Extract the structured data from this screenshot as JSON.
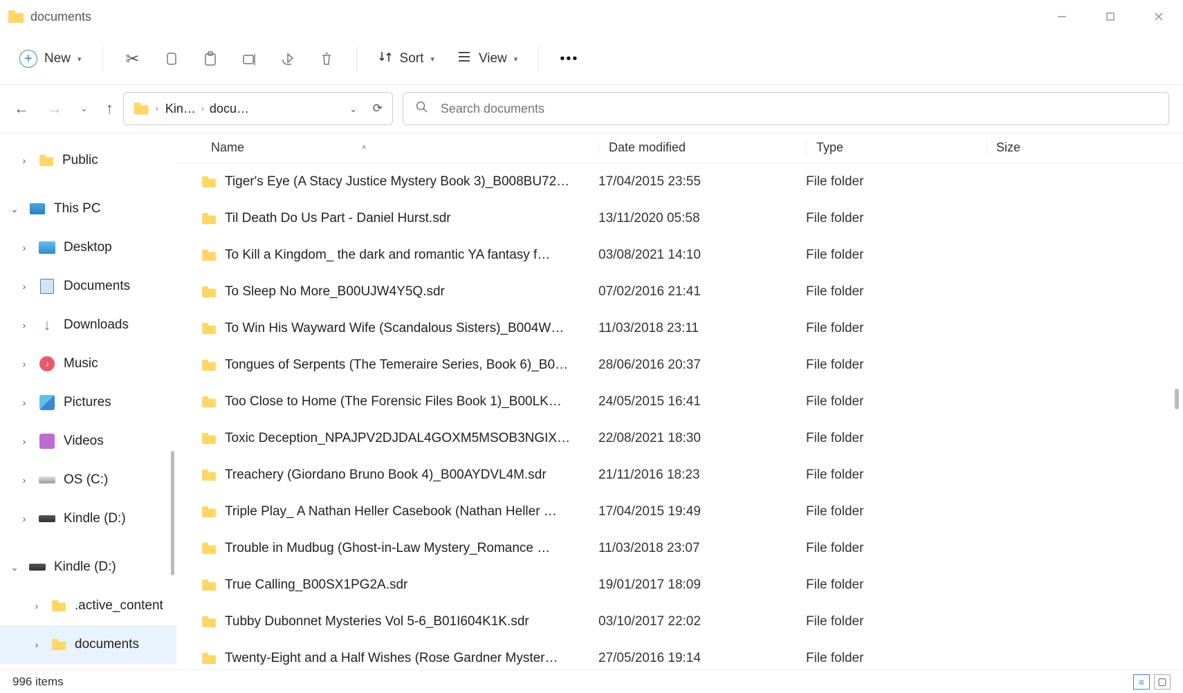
{
  "window": {
    "title": "documents"
  },
  "toolbar": {
    "new": "New",
    "sort": "Sort",
    "view": "View"
  },
  "address": {
    "crumb1": "Kin…",
    "crumb2": "docu…"
  },
  "search": {
    "placeholder": "Search documents"
  },
  "columns": {
    "name": "Name",
    "date": "Date modified",
    "type": "Type",
    "size": "Size"
  },
  "sidebar": {
    "public": "Public",
    "thispc": "This PC",
    "desktop": "Desktop",
    "documents": "Documents",
    "downloads": "Downloads",
    "music": "Music",
    "pictures": "Pictures",
    "videos": "Videos",
    "osc": "OS (C:)",
    "kindle_d_1": "Kindle (D:)",
    "kindle_d_2": "Kindle (D:)",
    "active_content": ".active_content",
    "documents_drive": "documents"
  },
  "rows": [
    {
      "name": "Tiger's Eye (A Stacy Justice Mystery Book 3)_B008BU72…",
      "date": "17/04/2015 23:55",
      "type": "File folder",
      "size": ""
    },
    {
      "name": "Til Death Do Us Part - Daniel Hurst.sdr",
      "date": "13/11/2020 05:58",
      "type": "File folder",
      "size": ""
    },
    {
      "name": "To Kill a Kingdom_ the dark and romantic YA fantasy f…",
      "date": "03/08/2021 14:10",
      "type": "File folder",
      "size": ""
    },
    {
      "name": "To Sleep No More_B00UJW4Y5Q.sdr",
      "date": "07/02/2016 21:41",
      "type": "File folder",
      "size": ""
    },
    {
      "name": "To Win His Wayward Wife (Scandalous Sisters)_B004W…",
      "date": "11/03/2018 23:11",
      "type": "File folder",
      "size": ""
    },
    {
      "name": "Tongues of Serpents (The Temeraire Series, Book 6)_B0…",
      "date": "28/06/2016 20:37",
      "type": "File folder",
      "size": ""
    },
    {
      "name": "Too Close to Home (The Forensic Files Book 1)_B00LK…",
      "date": "24/05/2015 16:41",
      "type": "File folder",
      "size": ""
    },
    {
      "name": "Toxic Deception_NPAJPV2DJDAL4GOXM5MSOB3NGIX…",
      "date": "22/08/2021 18:30",
      "type": "File folder",
      "size": ""
    },
    {
      "name": "Treachery (Giordano Bruno Book 4)_B00AYDVL4M.sdr",
      "date": "21/11/2016 18:23",
      "type": "File folder",
      "size": ""
    },
    {
      "name": "Triple Play_ A Nathan Heller Casebook (Nathan Heller …",
      "date": "17/04/2015 19:49",
      "type": "File folder",
      "size": ""
    },
    {
      "name": "Trouble in Mudbug (Ghost-in-Law Mystery_Romance …",
      "date": "11/03/2018 23:07",
      "type": "File folder",
      "size": ""
    },
    {
      "name": "True Calling_B00SX1PG2A.sdr",
      "date": "19/01/2017 18:09",
      "type": "File folder",
      "size": ""
    },
    {
      "name": "Tubby Dubonnet Mysteries Vol 5-6_B01I604K1K.sdr",
      "date": "03/10/2017 22:02",
      "type": "File folder",
      "size": ""
    },
    {
      "name": "Twenty-Eight and a Half Wishes (Rose Gardner Myster…",
      "date": "27/05/2016 19:14",
      "type": "File folder",
      "size": ""
    }
  ],
  "status": {
    "items": "996 items"
  }
}
